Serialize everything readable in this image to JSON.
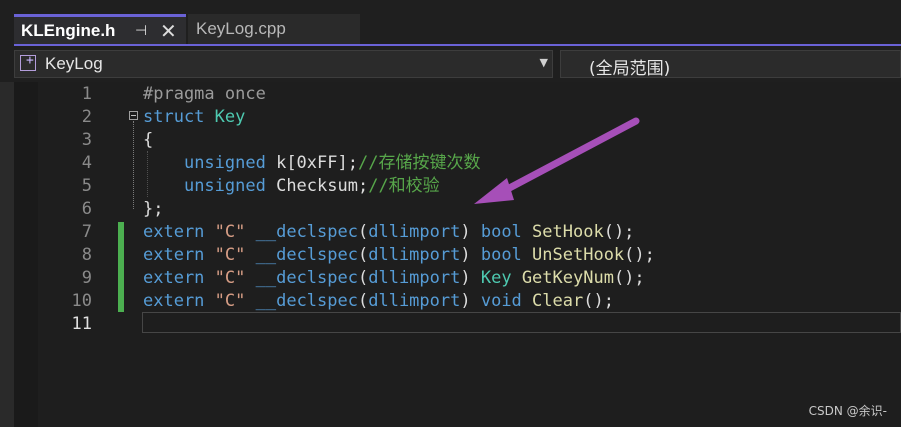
{
  "tabs": {
    "active": {
      "label": "KLEngine.h",
      "pin_icon": "pin-icon",
      "close_icon": "close-icon"
    },
    "inactive": {
      "label": "KeyLog.cpp"
    }
  },
  "navbar": {
    "class_scope": {
      "label": "KeyLog",
      "icon": "class-icon",
      "caret_icon": "chevron-down-icon"
    },
    "member_scope": {
      "label": "(全局范围)"
    }
  },
  "editor": {
    "line_numbers": [
      "1",
      "2",
      "3",
      "4",
      "5",
      "6",
      "7",
      "8",
      "9",
      "10",
      "11"
    ],
    "current_line": "11",
    "lines": [
      [
        {
          "t": "#pragma once",
          "c": "pp"
        }
      ],
      [
        {
          "t": "struct ",
          "c": "kw"
        },
        {
          "t": "Key",
          "c": "ty"
        }
      ],
      [
        {
          "t": "{",
          "c": "pl"
        }
      ],
      [
        {
          "t": "    ",
          "c": "pl"
        },
        {
          "t": "unsigned",
          "c": "kw"
        },
        {
          "t": " k[0xFF];",
          "c": "pl"
        },
        {
          "t": "//存储按键次数",
          "c": "cm"
        }
      ],
      [
        {
          "t": "    ",
          "c": "pl"
        },
        {
          "t": "unsigned",
          "c": "kw"
        },
        {
          "t": " Checksum;",
          "c": "pl"
        },
        {
          "t": "//和校验",
          "c": "cm"
        }
      ],
      [
        {
          "t": "};",
          "c": "pl"
        }
      ],
      [
        {
          "t": "extern ",
          "c": "kw"
        },
        {
          "t": "\"C\"",
          "c": "st"
        },
        {
          "t": " ",
          "c": "pl"
        },
        {
          "t": "__declspec",
          "c": "kw"
        },
        {
          "t": "(",
          "c": "pl"
        },
        {
          "t": "dllimport",
          "c": "kw"
        },
        {
          "t": ") ",
          "c": "pl"
        },
        {
          "t": "bool",
          "c": "kw"
        },
        {
          "t": " ",
          "c": "pl"
        },
        {
          "t": "SetHook",
          "c": "fn"
        },
        {
          "t": "();",
          "c": "pl"
        }
      ],
      [
        {
          "t": "extern ",
          "c": "kw"
        },
        {
          "t": "\"C\"",
          "c": "st"
        },
        {
          "t": " ",
          "c": "pl"
        },
        {
          "t": "__declspec",
          "c": "kw"
        },
        {
          "t": "(",
          "c": "pl"
        },
        {
          "t": "dllimport",
          "c": "kw"
        },
        {
          "t": ") ",
          "c": "pl"
        },
        {
          "t": "bool",
          "c": "kw"
        },
        {
          "t": " ",
          "c": "pl"
        },
        {
          "t": "UnSetHook",
          "c": "fn"
        },
        {
          "t": "();",
          "c": "pl"
        }
      ],
      [
        {
          "t": "extern ",
          "c": "kw"
        },
        {
          "t": "\"C\"",
          "c": "st"
        },
        {
          "t": " ",
          "c": "pl"
        },
        {
          "t": "__declspec",
          "c": "kw"
        },
        {
          "t": "(",
          "c": "pl"
        },
        {
          "t": "dllimport",
          "c": "kw"
        },
        {
          "t": ") ",
          "c": "pl"
        },
        {
          "t": "Key",
          "c": "ty"
        },
        {
          "t": " ",
          "c": "pl"
        },
        {
          "t": "GetKeyNum",
          "c": "fn"
        },
        {
          "t": "();",
          "c": "pl"
        }
      ],
      [
        {
          "t": "extern ",
          "c": "kw"
        },
        {
          "t": "\"C\"",
          "c": "st"
        },
        {
          "t": " ",
          "c": "pl"
        },
        {
          "t": "__declspec",
          "c": "kw"
        },
        {
          "t": "(",
          "c": "pl"
        },
        {
          "t": "dllimport",
          "c": "kw"
        },
        {
          "t": ") ",
          "c": "pl"
        },
        {
          "t": "void",
          "c": "kw"
        },
        {
          "t": " ",
          "c": "pl"
        },
        {
          "t": "Clear",
          "c": "fn"
        },
        {
          "t": "();",
          "c": "pl"
        }
      ],
      []
    ]
  },
  "annotation": {
    "arrow_color": "#a64fb8"
  },
  "watermark": {
    "text": "CSDN @余识-"
  },
  "colors": {
    "accent": "#6a62d6",
    "keyword": "#569cd6",
    "type": "#4ec9b0",
    "string": "#d69d85",
    "function": "#dcdcaa",
    "comment": "#57a64a",
    "change_bar": "#4caf50"
  }
}
